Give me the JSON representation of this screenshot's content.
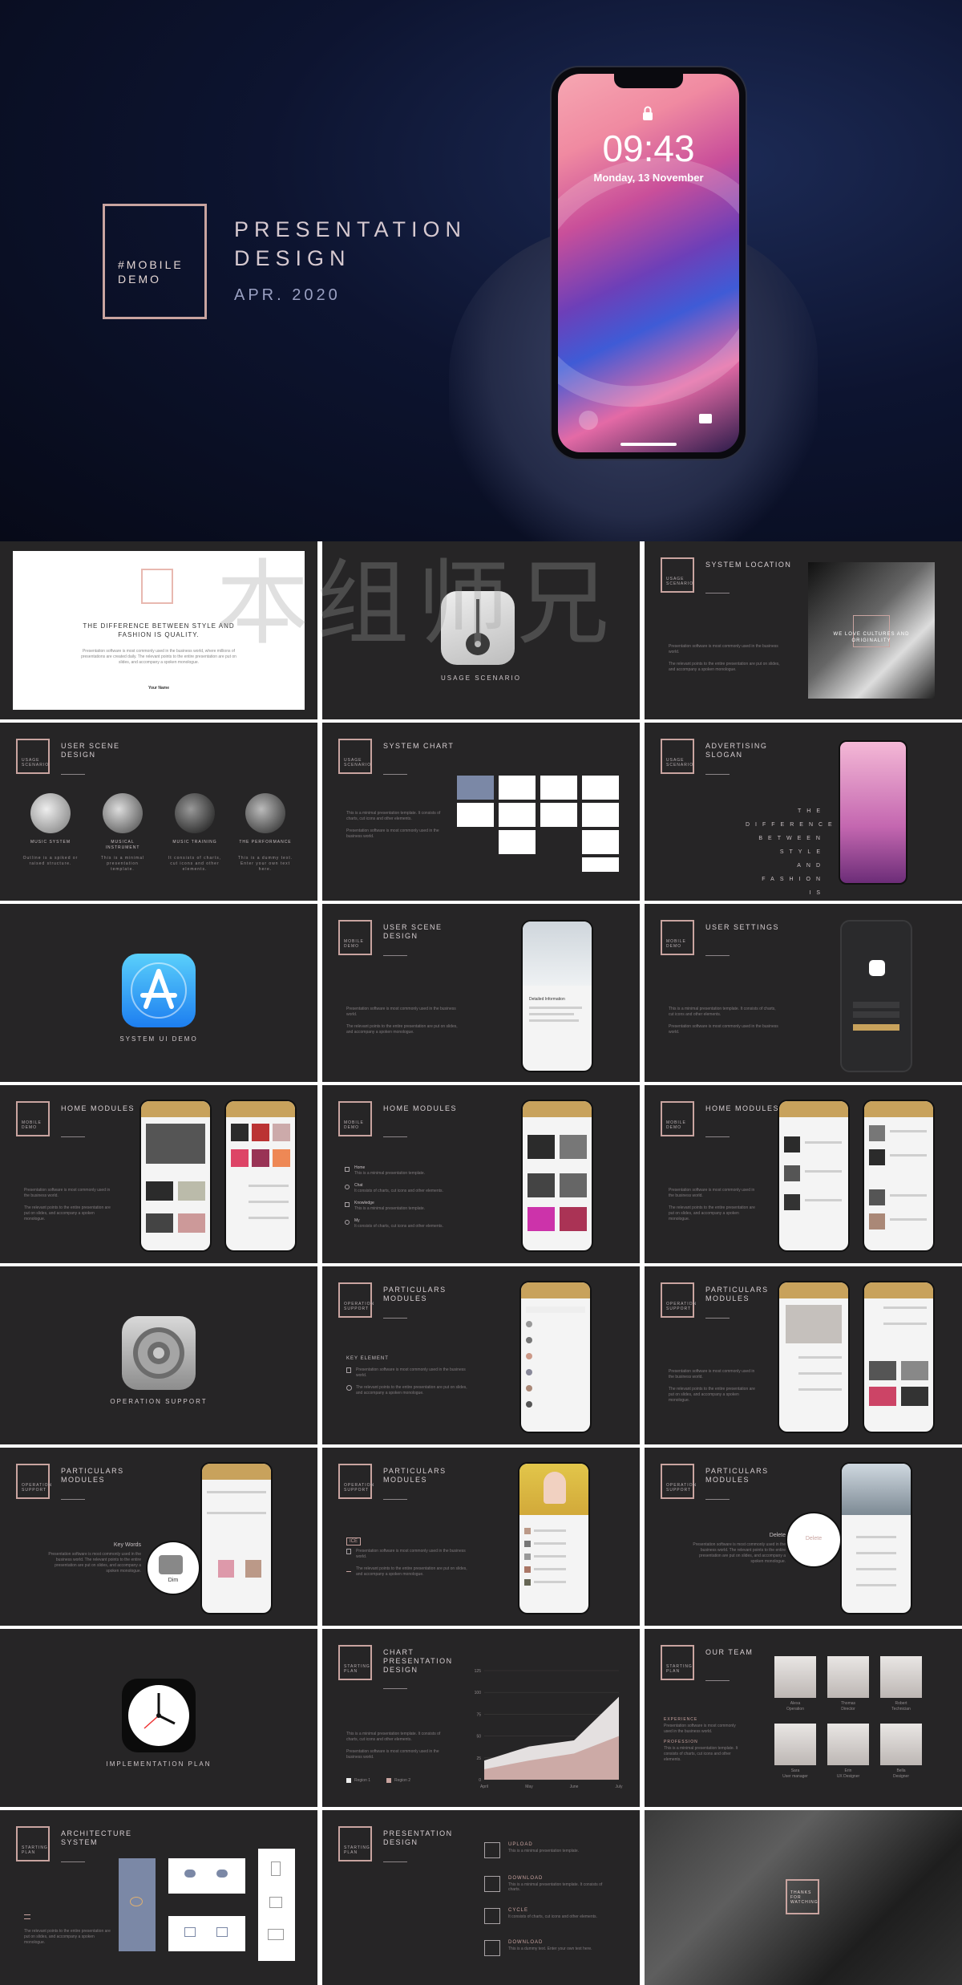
{
  "hero": {
    "box_text": "#MOBILE DEMO",
    "title": "PRESENTATION DESIGN",
    "date": "APR. 2020",
    "phone_time": "09:43",
    "phone_date": "Monday, 13 November"
  },
  "watermark": "本组师兄",
  "slides": {
    "s1": {
      "heading": "THE DIFFERENCE BETWEEN STYLE AND FASHION IS QUALITY.",
      "body": "Presentation software is most commonly used in the business world, where millions of presentations are created daily. The relevant points to the entire presentation are put on slides, and accompany a spoken monologue.",
      "footer": "Your Name"
    },
    "s2": {
      "label": "USAGE SCENARIO"
    },
    "s3": {
      "box": "USAGE SCENARIO",
      "title": "SYSTEM LOCATION",
      "body1": "Presentation software is most commonly used in the business world.",
      "body2": "The relevant points to the entire presentation are put on slides, and accompany a spoken monologue.",
      "photo_text": "WE LOVE CULTURES AND ORIGINALITY"
    },
    "s4": {
      "box": "USAGE SCENARIO",
      "title": "USER SCENE DESIGN",
      "items": [
        {
          "label": "MUSIC SYSTEM",
          "desc": "Outline is a spiked or raised structure."
        },
        {
          "label": "MUSICAL INSTRUMENT",
          "desc": "This is a minimal presentation template."
        },
        {
          "label": "MUSIC TRAINING",
          "desc": "It consists of charts, cut icons and other elements."
        },
        {
          "label": "THE PERFORMANCE",
          "desc": "This is a dummy text. Enter your own text here."
        }
      ]
    },
    "s5": {
      "box": "USAGE SCENARIO",
      "title": "SYSTEM CHART",
      "body1": "This is a minimal presentation template. It consists of charts, cut icons and other elements.",
      "body2": "Presentation software is most commonly used in the business world."
    },
    "s6": {
      "box": "USAGE SCENARIO",
      "title": "ADVERTISING SLOGAN",
      "slogan": "THE DIFFERENCE BETWEEN STYLE AND FASHION IS QUALITY"
    },
    "s7": {
      "label": "SYSTEM UI DEMO"
    },
    "s8": {
      "box": "MOBILE DEMO",
      "title": "USER SCENE DESIGN",
      "body1": "Presentation software is most commonly used in the business world.",
      "body2": "The relevant points to the entire presentation are put on slides, and accompany a spoken monologue.",
      "phone_caption": "Detailed Information"
    },
    "s9": {
      "box": "MOBILE DEMO",
      "title": "USER SETTINGS",
      "body1": "This is a minimal presentation template. It consists of charts, cut icons and other elements.",
      "body2": "Presentation software is most commonly used in the business world."
    },
    "s10": {
      "box": "MOBILE DEMO",
      "title": "HOME MODULES",
      "body1": "Presentation software is most commonly used in the business world.",
      "body2": "The relevant points to the entire presentation are put on slides, and accompany a spoken monologue."
    },
    "s11": {
      "box": "MOBILE DEMO",
      "title": "HOME MODULES",
      "items": [
        {
          "name": "Home",
          "desc": "This is a minimal presentation template."
        },
        {
          "name": "Chat",
          "desc": "It consists of charts, cut icons and other elements."
        },
        {
          "name": "Knowledge",
          "desc": "This is a minimal presentation template."
        },
        {
          "name": "My",
          "desc": "It consists of charts, cut icons and other elements."
        }
      ]
    },
    "s12": {
      "box": "MOBILE DEMO",
      "title": "HOME MODULES",
      "body1": "Presentation software is most commonly used in the business world.",
      "body2": "The relevant points to the entire presentation are put on slides, and accompany a spoken monologue."
    },
    "s13": {
      "label": "OPERATION SUPPORT"
    },
    "s14": {
      "box": "OPERATION SUPPORT",
      "title": "PARTICULARS MODULES",
      "key": "KEY ELEMENT",
      "body1": "Presentation software is most commonly used in the business world.",
      "body2": "The relevant points to the entire presentation are put on slides, and accompany a spoken monologue."
    },
    "s15": {
      "box": "OPERATION SUPPORT",
      "title": "PARTICULARS MODULES",
      "body1": "Presentation software is most commonly used in the business world.",
      "body2": "The relevant points to the entire presentation are put on slides, and accompany a spoken monologue."
    },
    "s16": {
      "box": "OPERATION SUPPORT",
      "title": "PARTICULARS MODULES",
      "key": "Key Words",
      "body": "Presentation software is most commonly used in the business world. The relevant points to the entire presentation are put on slides, and accompany a spoken monologue.",
      "bubble": "Dim"
    },
    "s17": {
      "box": "OPERATION SUPPORT",
      "title": "PARTICULARS MODULES",
      "badge": "ICE",
      "body1": "Presentation software is most commonly used in the business world.",
      "body2": "The relevant points to the entire presentation are put on slides, and accompany a spoken monologue."
    },
    "s18": {
      "box": "OPERATION SUPPORT",
      "title": "PARTICULARS MODULES",
      "key": "Delete",
      "body": "Presentation software is most commonly used in the business world. The relevant points to the entire presentation are put on slides, and accompany a spoken monologue.",
      "bubble": "Delete"
    },
    "s19": {
      "label": "IMPLEMENTATION PLAN"
    },
    "s20": {
      "box": "STARTING PLAN",
      "title": "CHART PRESENTATION DESIGN",
      "body1": "This is a minimal presentation template. It consists of charts, cut icons and other elements.",
      "body2": "Presentation software is most commonly used in the business world.",
      "legend": [
        "Region 1",
        "Region 2"
      ]
    },
    "s21": {
      "box": "STARTING PLAN",
      "title": "OUR TEAM",
      "label1": "EXPERIENCE",
      "body1": "Presentation software is most commonly used in the business world.",
      "label2": "PROFESSION",
      "body2": "This is a minimal presentation template. It consists of charts, cut icons and other elements.",
      "members": [
        {
          "name": "Alexa",
          "role": "Operation"
        },
        {
          "name": "Thomas",
          "role": "Director"
        },
        {
          "name": "Robert",
          "role": "Technician"
        },
        {
          "name": "Sara",
          "role": "User manager"
        },
        {
          "name": "Erin",
          "role": "UX Designer"
        },
        {
          "name": "Bella",
          "role": "Designer"
        }
      ]
    },
    "s22": {
      "box": "STARTING PLAN",
      "title": "ARCHITECTURE SYSTEM",
      "body": "The relevant points to the entire presentation are put on slides, and accompany a spoken monologue."
    },
    "s23": {
      "box": "STARTING PLAN",
      "title": "PRESENTATION DESIGN",
      "items": [
        {
          "name": "UPLOAD",
          "desc": "This is a minimal presentation template."
        },
        {
          "name": "DOWNLOAD",
          "desc": "This is a minimal presentation template. It consists of charts."
        },
        {
          "name": "CYCLE",
          "desc": "It consists of charts, cut icons and other elements."
        },
        {
          "name": "DOWNLOAD",
          "desc": "This is a dummy text. Enter your own text here."
        }
      ]
    },
    "s24": {
      "box": "THANKS FOR WATCHING"
    }
  },
  "chart_data": {
    "type": "area",
    "categories": [
      "April",
      "May",
      "June",
      "July"
    ],
    "series": [
      {
        "name": "Region 1",
        "values": [
          22,
          38,
          45,
          95
        ]
      },
      {
        "name": "Region 2",
        "values": [
          12,
          22,
          30,
          50
        ]
      }
    ],
    "yticks": [
      0,
      25,
      50,
      75,
      100,
      125
    ],
    "ylim": [
      0,
      125
    ]
  },
  "colors": {
    "accent": "#c9a4a0",
    "slide_bg": "#262526",
    "gold": "#c8a25c"
  }
}
